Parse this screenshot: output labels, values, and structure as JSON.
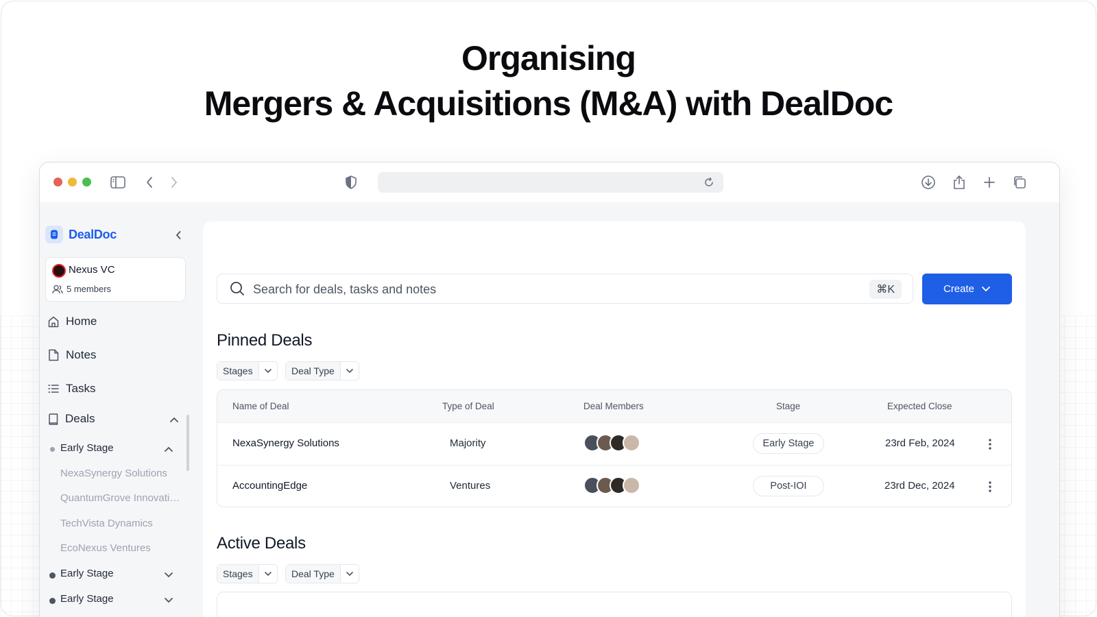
{
  "headline": {
    "line1": "Organising",
    "line2": "Mergers & Acquisitions (M&A) with DealDoc"
  },
  "browser": {
    "traffic_colors": [
      "#e0645a",
      "#f0b83a",
      "#4bbf4f"
    ],
    "icons": [
      "sidebar-toggle-icon",
      "back-icon",
      "forward-icon",
      "shield-icon",
      "reload-icon",
      "download-icon",
      "share-icon",
      "new-tab-icon",
      "tabs-overview-icon"
    ]
  },
  "sidebar": {
    "brand": "DealDoc",
    "brand_color": "#1d5cf0",
    "workspace": {
      "name": "Nexus VC",
      "members": "5 members"
    },
    "nav": [
      {
        "label": "Home",
        "icon": "home-icon"
      },
      {
        "label": "Notes",
        "icon": "note-icon"
      },
      {
        "label": "Tasks",
        "icon": "list-icon"
      },
      {
        "label": "Deals",
        "icon": "book-icon"
      }
    ],
    "deal_groups": [
      {
        "label": "Early Stage",
        "expanded": true,
        "deals": [
          "NexaSynergy Solutions",
          "QuantumGrove Innovatio...",
          "TechVista Dynamics",
          "EcoNexus Ventures"
        ]
      },
      {
        "label": "Early Stage",
        "expanded": false
      },
      {
        "label": "Early Stage",
        "expanded": false
      }
    ]
  },
  "main": {
    "search": {
      "placeholder": "Search for deals, tasks and notes",
      "shortcut": "⌘K"
    },
    "create_label": "Create",
    "accent": "#1f5fe6",
    "pinned": {
      "title": "Pinned Deals",
      "filters": [
        "Stages",
        "Deal Type"
      ],
      "columns": [
        "Name of Deal",
        "Type of Deal",
        "Deal Members",
        "Stage",
        "Expected Close"
      ],
      "rows": [
        {
          "name": "NexaSynergy Solutions",
          "type": "Majority",
          "stage": "Early Stage",
          "close": "23rd Feb, 2024"
        },
        {
          "name": "AccountingEdge",
          "type": "Ventures",
          "stage": "Post-IOI",
          "close": "23rd Dec, 2024"
        }
      ]
    },
    "active": {
      "title": "Active Deals",
      "filters": [
        "Stages",
        "Deal Type"
      ]
    }
  }
}
